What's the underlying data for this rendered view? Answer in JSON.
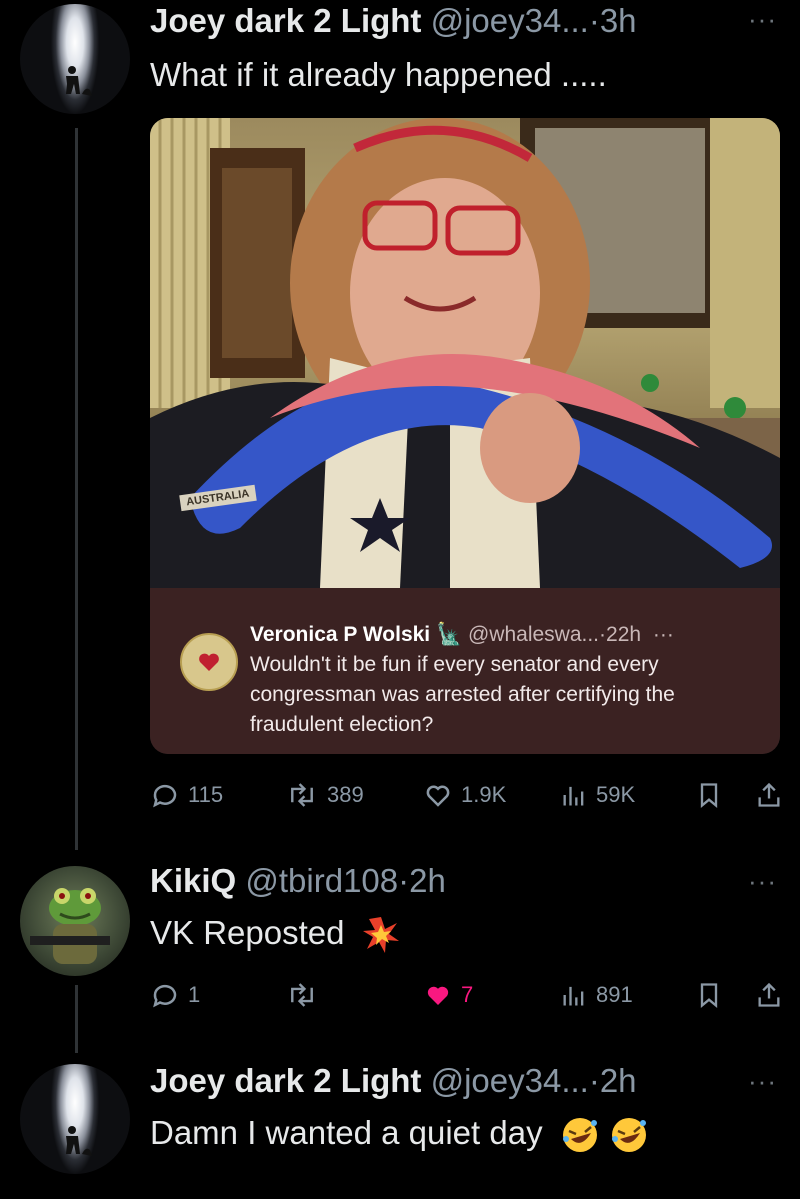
{
  "tweets": [
    {
      "name": "Joey dark 2 Light",
      "handle": "@joey34...",
      "time": "·3h",
      "text": "What if it already happened .....",
      "quote": {
        "name": "Veronica P Wolski",
        "handle": "@whaleswa...",
        "time": "·22h",
        "text": "Wouldn't it be fun if every senator and every congressman was arrested after certifying the fraudulent election?",
        "photo_label": "AUSTRALIA"
      },
      "metrics": {
        "replies": "115",
        "reposts": "389",
        "likes": "1.9K",
        "views": "59K"
      }
    },
    {
      "name": "KikiQ",
      "handle": "@tbird108",
      "time": "·2h",
      "text": "VK Reposted",
      "metrics": {
        "replies": "1",
        "reposts": "",
        "likes": "7",
        "views": "891"
      }
    },
    {
      "name": "Joey dark 2 Light",
      "handle": "@joey34...",
      "time": "·2h",
      "text": "Damn I wanted a quiet day"
    }
  ],
  "icons": {
    "more": "more-icon",
    "reply": "reply-icon",
    "repost": "repost-icon",
    "like": "heart-icon",
    "views": "views-icon",
    "bookmark": "bookmark-icon",
    "share": "share-icon"
  },
  "colors": {
    "background": "#000000",
    "text": "#e7e9ea",
    "muted": "#8b98a5",
    "liked": "#f91880",
    "quote_bg": "#3b2222"
  }
}
